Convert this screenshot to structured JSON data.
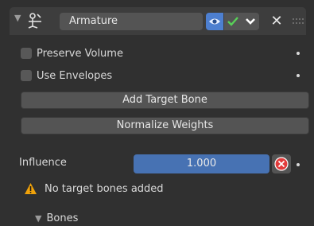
{
  "header": {
    "collapse_glyph": "▼",
    "modifier_icon": "armature-modifier-icon",
    "name_value": "Armature",
    "close_glyph": "✕",
    "colors": {
      "eye_active": "#4d7fd0",
      "check": "#58d058",
      "close_circle": "#e23b3b"
    }
  },
  "options": {
    "preserve_volume": {
      "label": "Preserve Volume",
      "checked": false
    },
    "use_envelopes": {
      "label": "Use Envelopes",
      "checked": false
    }
  },
  "buttons": {
    "add_target_bone": "Add Target Bone",
    "normalize_weights": "Normalize Weights"
  },
  "influence": {
    "label": "Influence",
    "value": "1.000"
  },
  "warning": {
    "icon": "warning-triangle-icon",
    "text": "No target bones added"
  },
  "subpanel": {
    "collapse_glyph": "▼",
    "label": "Bones"
  }
}
